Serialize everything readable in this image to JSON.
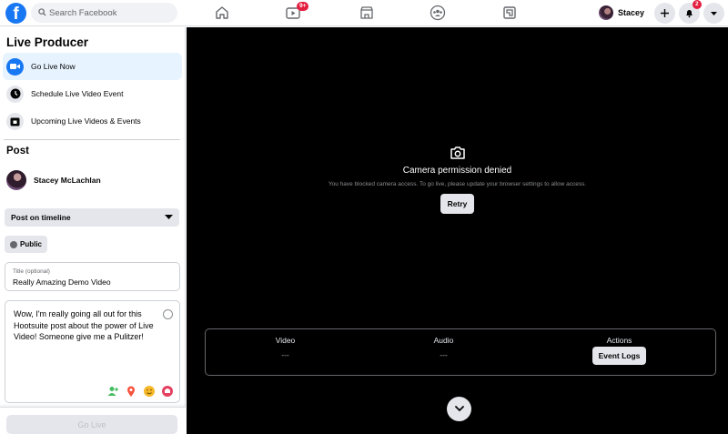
{
  "topbar": {
    "logo_letter": "f",
    "search_placeholder": "Search Facebook",
    "watch_badge": "9+",
    "profile_name": "Stacey",
    "notifications_badge": "2"
  },
  "sidebar": {
    "title": "Live Producer",
    "items": [
      {
        "label": "Go Live Now",
        "icon": "video-camera-icon"
      },
      {
        "label": "Schedule Live Video Event",
        "icon": "clock-icon"
      },
      {
        "label": "Upcoming Live Videos & Events",
        "icon": "calendar-icon"
      }
    ],
    "post_title": "Post",
    "author_name": "Stacey McLachlan",
    "destination": "Post on timeline",
    "audience": "Public",
    "title_label": "Title (optional)",
    "title_value": "Really Amazing Demo Video",
    "description": "Wow, I'm really going all out for this Hootsuite post about the power of Live Video! Someone give me a Pulitzer!",
    "go_live_label": "Go Live"
  },
  "main": {
    "permission_title": "Camera permission denied",
    "permission_subtitle": "You have blocked camera access. To go live, please update your browser settings to allow access.",
    "retry_label": "Retry",
    "stats": {
      "video_label": "Video",
      "video_value": "---",
      "audio_label": "Audio",
      "audio_value": "---",
      "actions_label": "Actions",
      "event_logs_label": "Event Logs"
    }
  },
  "colors": {
    "brand_blue": "#1877f2",
    "badge_red": "#e41e3f",
    "active_item_bg": "#e7f3ff"
  }
}
